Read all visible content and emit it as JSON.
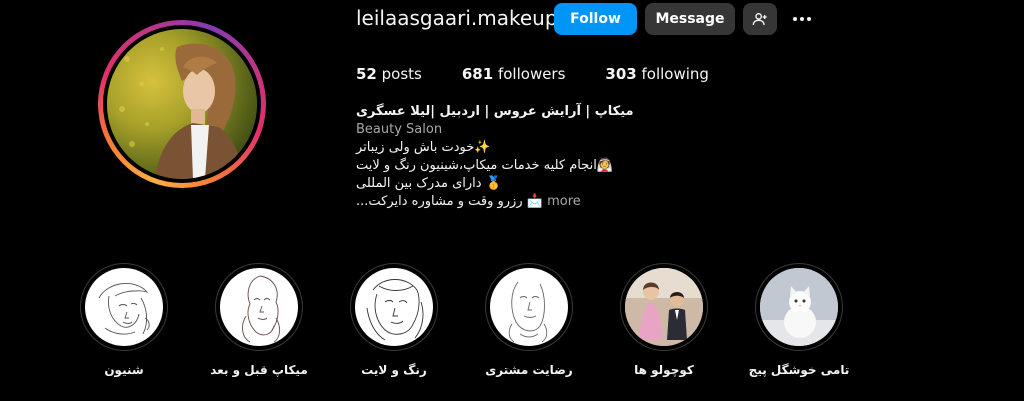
{
  "profile": {
    "username": "leilaasgaari.makeup",
    "follow_label": "Follow",
    "message_label": "Message",
    "stats": {
      "posts_count": "52",
      "posts_label": "posts",
      "followers_count": "681",
      "followers_label": "followers",
      "following_count": "303",
      "following_label": "following"
    },
    "bio": {
      "name": "میکاپ | آرایش عروس | اردبیل |لیلا عسگری",
      "category": "Beauty Salon",
      "lines": [
        "✨خودت باش ولی زیباتر",
        "👰انجام کلیه خدمات میکاپ،شینیون رنگ و لایت",
        "🥇 دارای مدرک بین المللی",
        "📩 رزرو وقت و مشاوره دایرکت..."
      ],
      "more_label": "more"
    }
  },
  "highlights": [
    {
      "label": "شنیون",
      "icon": "line-art-woman-hat"
    },
    {
      "label": "میکاپ قبل و بعد",
      "icon": "line-art-woman-profile"
    },
    {
      "label": "رنگ و لایت",
      "icon": "line-art-woman-hair"
    },
    {
      "label": "رضایت مشتری",
      "icon": "line-art-woman-face"
    },
    {
      "label": "کوچولو ها",
      "icon": "children-photo"
    },
    {
      "label": "تامی خوشگل پیج",
      "icon": "white-cat-photo"
    }
  ],
  "colors": {
    "background": "#000000",
    "follow_button": "#0095f6",
    "secondary_button": "#363636",
    "muted_text": "#a8a8a8"
  }
}
